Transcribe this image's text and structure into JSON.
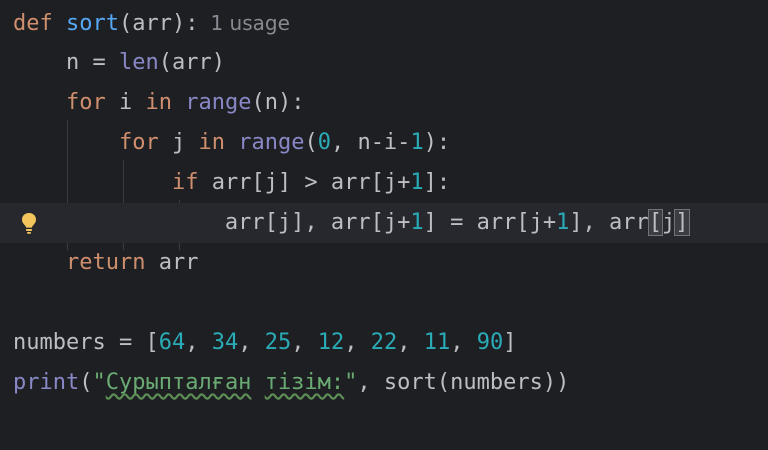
{
  "editor": {
    "line1": {
      "kw": "def",
      "fn": "sort",
      "rest": "(arr):",
      "hint": "1 usage"
    },
    "line2": {
      "indent": "    ",
      "pre": "n = ",
      "bi": "len",
      "rest": "(arr)"
    },
    "line3": {
      "indent": "    ",
      "kw1": "for",
      "mid1": " i ",
      "kw2": "in",
      "sp": " ",
      "bi": "range",
      "rest": "(n):"
    },
    "line4": {
      "indent": "        ",
      "kw1": "for",
      "mid1": " j ",
      "kw2": "in",
      "sp": " ",
      "bi": "range",
      "p1": "(",
      "n1": "0",
      "p2": ", n-i-",
      "n2": "1",
      "p3": "):"
    },
    "line5": {
      "indent": "            ",
      "kw": "if",
      "p1": " arr[j] > arr[j+",
      "n1": "1",
      "p2": "]:"
    },
    "line6": {
      "indent": "                ",
      "p1": "arr[j], arr[j+",
      "n1": "1",
      "p2": "] = arr[j+",
      "n2": "1",
      "p3": "], arr",
      "b": "[",
      "p4": "j",
      "b2": "]"
    },
    "line7": {
      "indent": "    ",
      "kw": "return",
      "rest": " arr"
    },
    "line9": {
      "p1": "numbers = [",
      "v1": "64",
      "c1": ", ",
      "v2": "34",
      "c2": ", ",
      "v3": "25",
      "c3": ", ",
      "v4": "12",
      "c4": ", ",
      "v5": "22",
      "c5": ", ",
      "v6": "11",
      "c6": ", ",
      "v7": "90",
      "p2": "]"
    },
    "line10": {
      "bi": "print",
      "p1": "(",
      "q1": "\"",
      "w1": "Сурыпталған",
      "sp": " ",
      "w2": "тізім:",
      "q2": "\"",
      "p2": ", sort(numbers))"
    }
  },
  "colors": {
    "background": "#1e1f22",
    "current_line": "#26282e",
    "keyword": "#cf8e6d",
    "function": "#56a8f5",
    "builtin": "#8888c6",
    "number": "#2aacb8",
    "string": "#6aab73",
    "text": "#bcbec4"
  },
  "gutter": {
    "icon": "lightbulb-icon"
  }
}
